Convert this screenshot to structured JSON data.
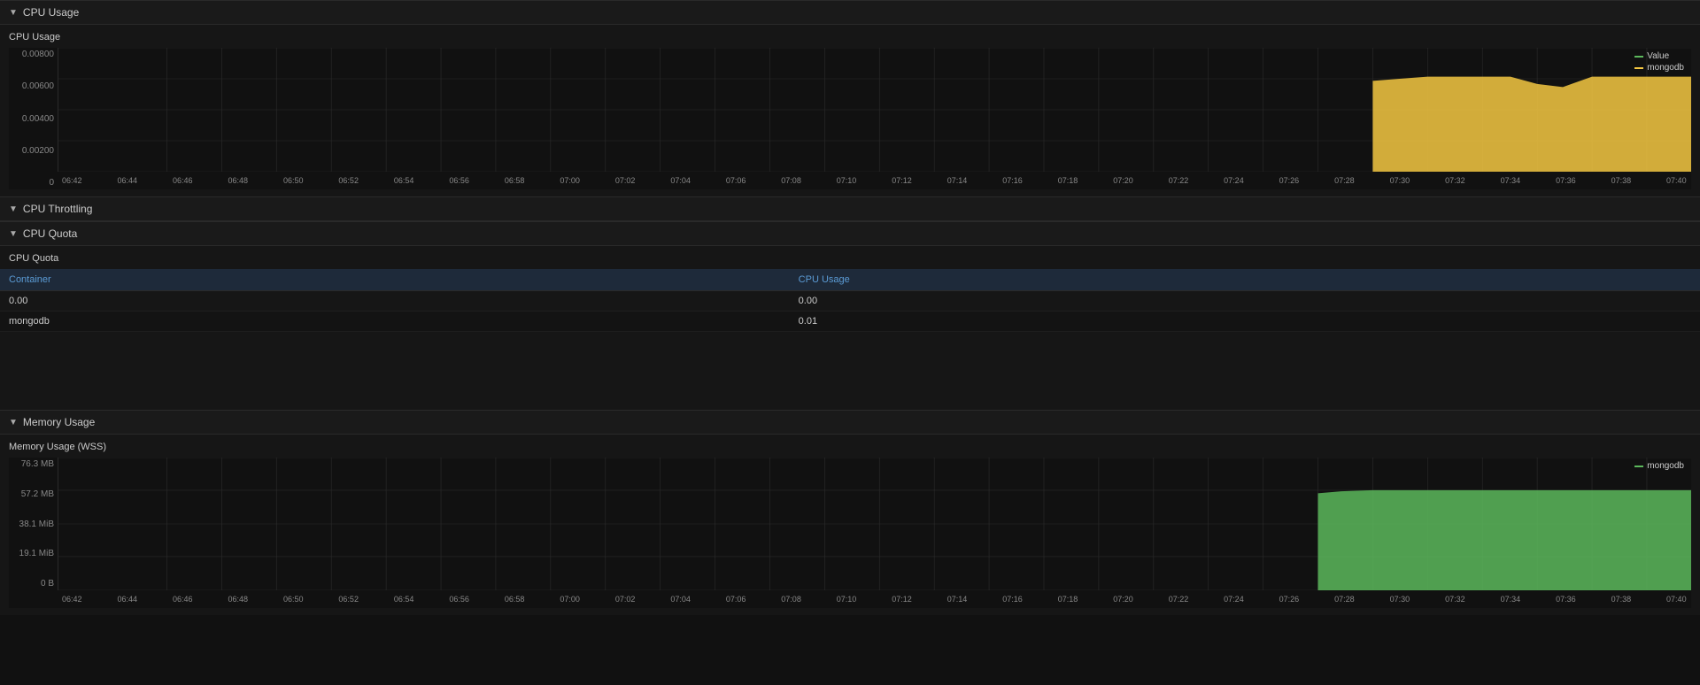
{
  "sections": {
    "cpu_usage_header": "CPU Usage",
    "cpu_throttling_header": "CPU Throttling",
    "cpu_quota_header": "CPU Quota",
    "memory_usage_header": "Memory Usage"
  },
  "cpu_chart": {
    "title": "CPU Usage",
    "y_labels": [
      "0",
      "0.00200",
      "0.00400",
      "0.00600",
      "0.00800"
    ],
    "x_labels": [
      "06:42",
      "06:44",
      "06:46",
      "06:48",
      "06:50",
      "06:52",
      "06:54",
      "06:56",
      "06:58",
      "07:00",
      "07:02",
      "07:04",
      "07:06",
      "07:08",
      "07:10",
      "07:12",
      "07:14",
      "07:16",
      "07:18",
      "07:20",
      "07:22",
      "07:24",
      "07:26",
      "07:28",
      "07:30",
      "07:32",
      "07:34",
      "07:36",
      "07:38",
      "07:40"
    ],
    "legend": [
      {
        "label": "Value",
        "color": "#5cb85c"
      },
      {
        "label": "mongodb",
        "color": "#f5c842"
      }
    ]
  },
  "cpu_quota_table": {
    "title": "CPU Quota",
    "columns": [
      "Container",
      "CPU Usage"
    ],
    "rows": [
      {
        "container": "0.00",
        "cpu_usage": "0.00"
      },
      {
        "container": "mongodb",
        "cpu_usage": "0.01"
      }
    ]
  },
  "memory_chart": {
    "title": "Memory Usage (WSS)",
    "y_labels": [
      "0 B",
      "19.1 MiB",
      "38.1 MiB",
      "57.2 MB",
      "76.3 MB"
    ],
    "x_labels": [
      "06:42",
      "06:44",
      "06:46",
      "06:48",
      "06:50",
      "06:52",
      "06:54",
      "06:56",
      "06:58",
      "07:00",
      "07:02",
      "07:04",
      "07:06",
      "07:08",
      "07:10",
      "07:12",
      "07:14",
      "07:16",
      "07:18",
      "07:20",
      "07:22",
      "07:24",
      "07:26",
      "07:28",
      "07:30",
      "07:32",
      "07:34",
      "07:36",
      "07:38",
      "07:40"
    ],
    "legend": [
      {
        "label": "mongodb",
        "color": "#5cb85c"
      }
    ]
  }
}
